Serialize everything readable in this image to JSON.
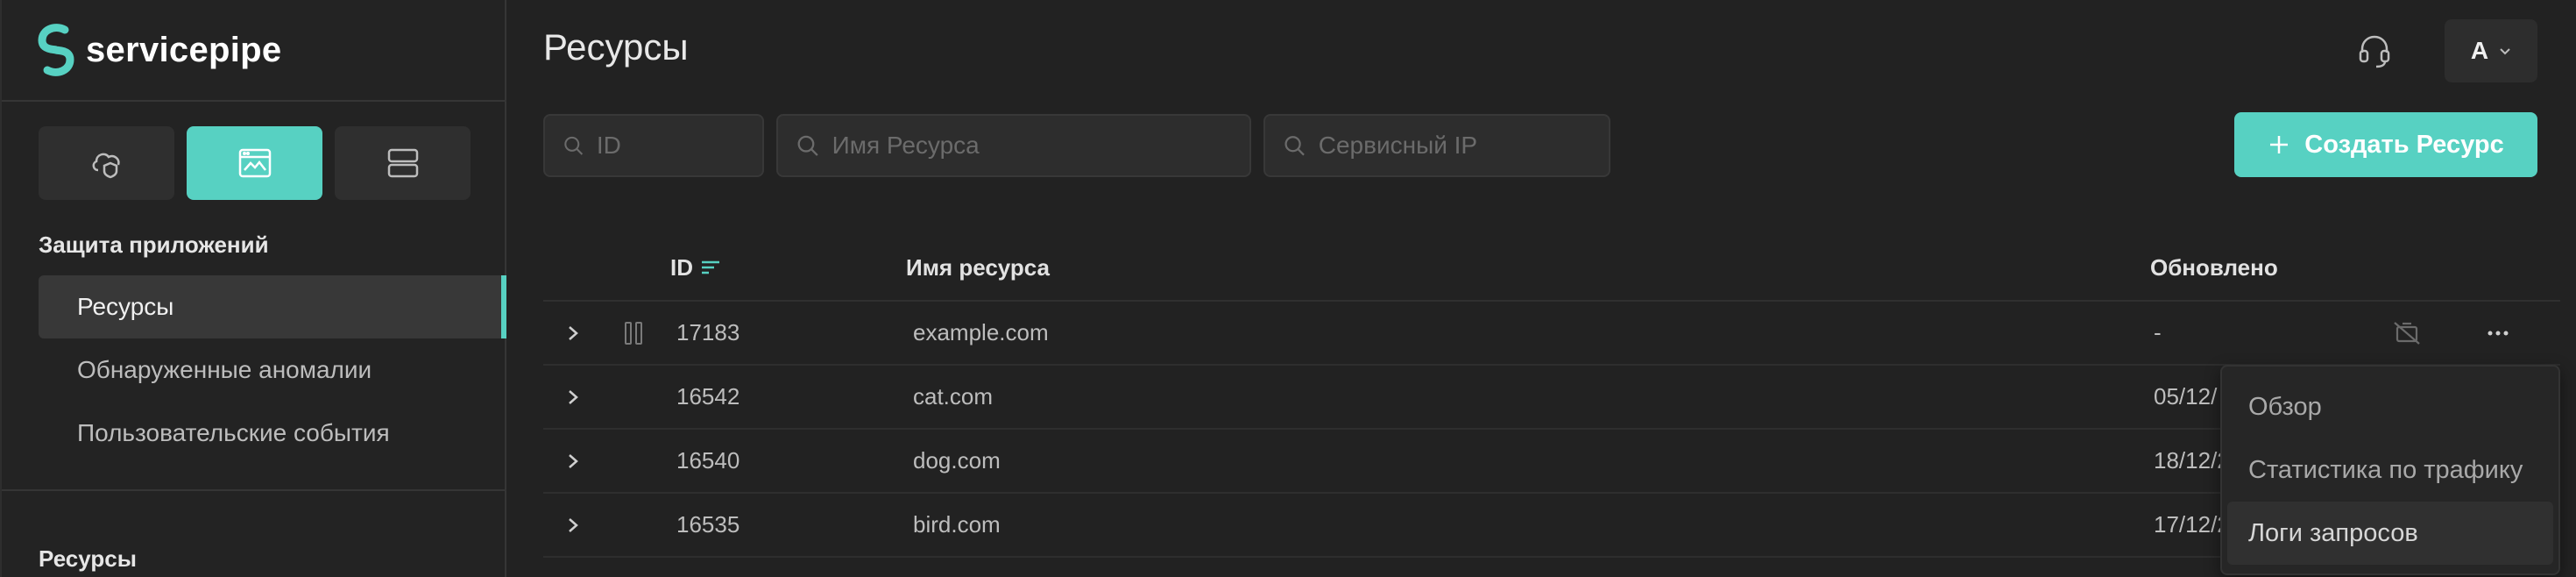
{
  "app": {
    "name": "servicepipe"
  },
  "colors": {
    "accent": "#57d1c2",
    "background": "#222222",
    "sidebar": "#232323"
  },
  "sidebar": {
    "products": [
      {
        "icon": "cloud-shield-icon",
        "active": false
      },
      {
        "icon": "app-window-icon",
        "active": true
      },
      {
        "icon": "server-icon",
        "active": false
      }
    ],
    "section_title": "Защита приложений",
    "items": [
      {
        "label": "Ресурсы",
        "active": true
      },
      {
        "label": "Обнаруженные аномалии",
        "active": false
      },
      {
        "label": "Пользовательские события",
        "active": false
      }
    ],
    "section2_title": "Ресурсы"
  },
  "header": {
    "title": "Ресурсы",
    "user_initial": "А"
  },
  "filters": {
    "id_placeholder": "ID",
    "name_placeholder": "Имя Ресурса",
    "ip_placeholder": "Сервисный IP"
  },
  "create_button": {
    "label": "Создать Ресурс"
  },
  "table": {
    "columns": {
      "id": "ID",
      "name": "Имя ресурса",
      "updated": "Обновлено"
    },
    "rows": [
      {
        "id": "17183",
        "name": "example.com",
        "updated": "-"
      },
      {
        "id": "16542",
        "name": "cat.com",
        "updated": "05/12/"
      },
      {
        "id": "16540",
        "name": "dog.com",
        "updated": "18/12/2"
      },
      {
        "id": "16535",
        "name": "bird.com",
        "updated": "17/12/2"
      }
    ]
  },
  "context_menu": {
    "items": [
      "Обзор",
      "Статистика по трафику",
      "Логи запросов"
    ]
  }
}
